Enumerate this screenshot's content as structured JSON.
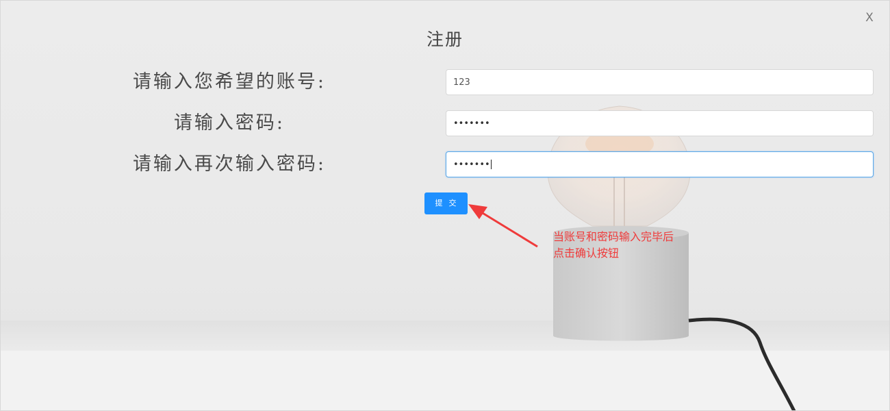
{
  "dialog": {
    "title": "注册",
    "close_label": "X"
  },
  "form": {
    "account_label": "请输入您希望的账号:",
    "account_value": "123",
    "password_label": "请输入密码:",
    "password_value": "•••••••",
    "confirm_label": "请输入再次输入密码:",
    "confirm_value": "•••••••",
    "submit_label": "提交"
  },
  "annotation": {
    "text": "当账号和密码输入完毕后点击确认按钮",
    "color": "#ef3b3b"
  },
  "colors": {
    "accent": "#1e90ff",
    "focus_border": "#5aa8e8"
  }
}
